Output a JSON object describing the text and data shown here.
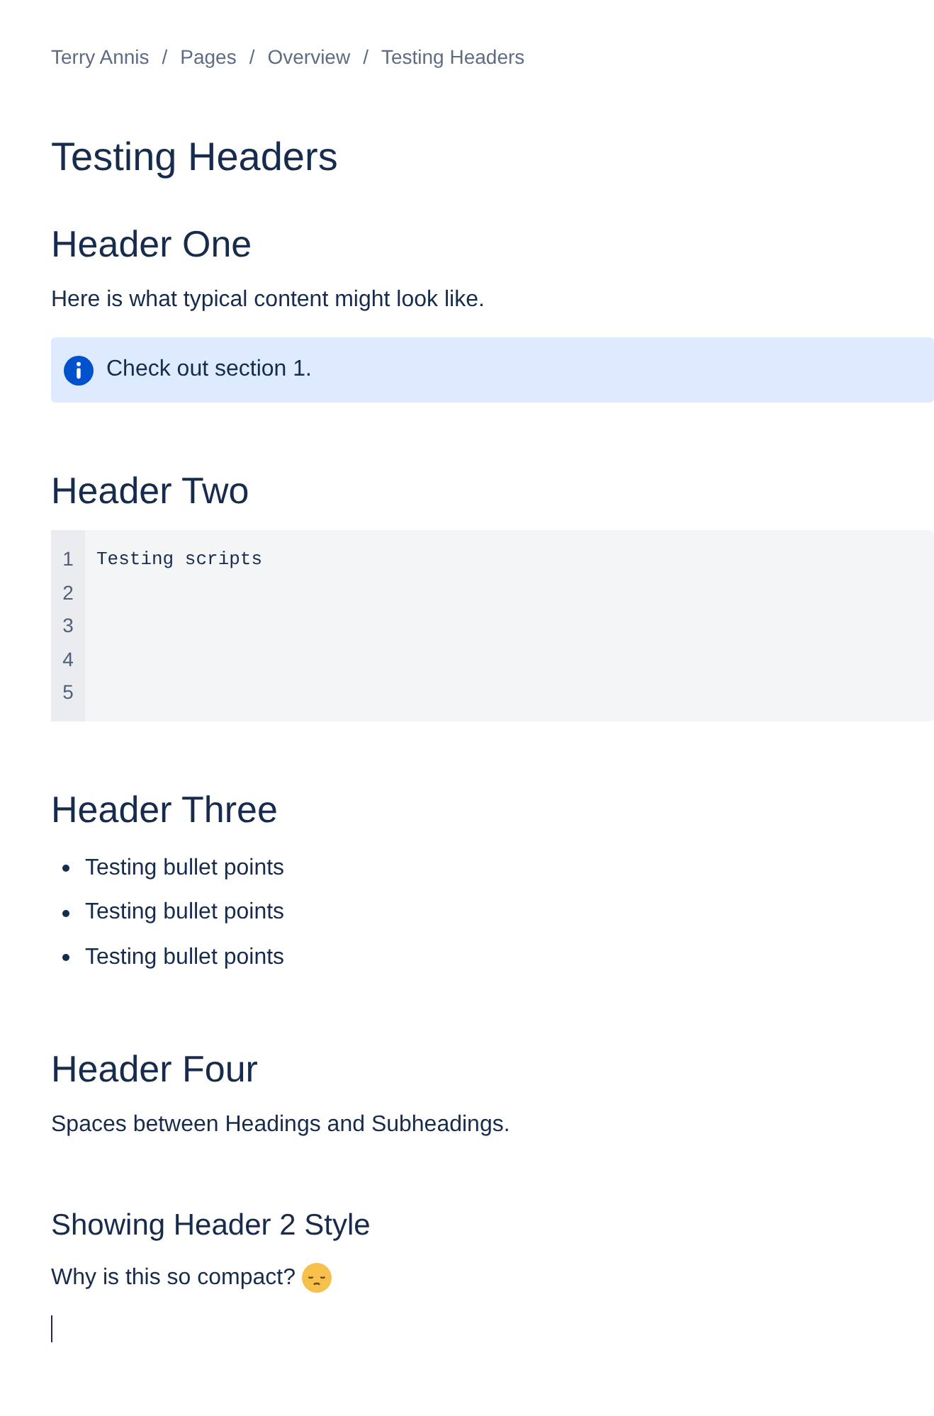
{
  "breadcrumbs": [
    "Terry Annis",
    "Pages",
    "Overview",
    "Testing Headers"
  ],
  "breadcrumb_separators": [
    "/",
    "/",
    "/"
  ],
  "title": "Testing Headers",
  "blocks": [
    {
      "kind": "heading",
      "text": "Header One"
    },
    {
      "kind": "paragraph",
      "text": "Here is what typical content might look like."
    },
    {
      "kind": "info",
      "text": "Check out section 1."
    },
    {
      "kind": "heading",
      "text": "Header Two"
    },
    {
      "kind": "code",
      "lines": [
        "Testing scripts"
      ],
      "line_numbers": [
        "1",
        "2",
        "3",
        "4",
        "5"
      ]
    },
    {
      "kind": "heading",
      "text": "Header Three"
    },
    {
      "kind": "bullets",
      "items": [
        "Testing bullet points",
        "Testing bullet points",
        "Testing bullet points"
      ]
    },
    {
      "kind": "heading",
      "text": "Header Four"
    },
    {
      "kind": "paragraph",
      "text": "Spaces between Headings and Subheadings."
    },
    {
      "kind": "subheading",
      "text": "Showing Header 2 Style"
    },
    {
      "kind": "paragraph",
      "text": "Why is this so compact?",
      "emoji": true
    },
    {
      "kind": "cursor"
    }
  ]
}
